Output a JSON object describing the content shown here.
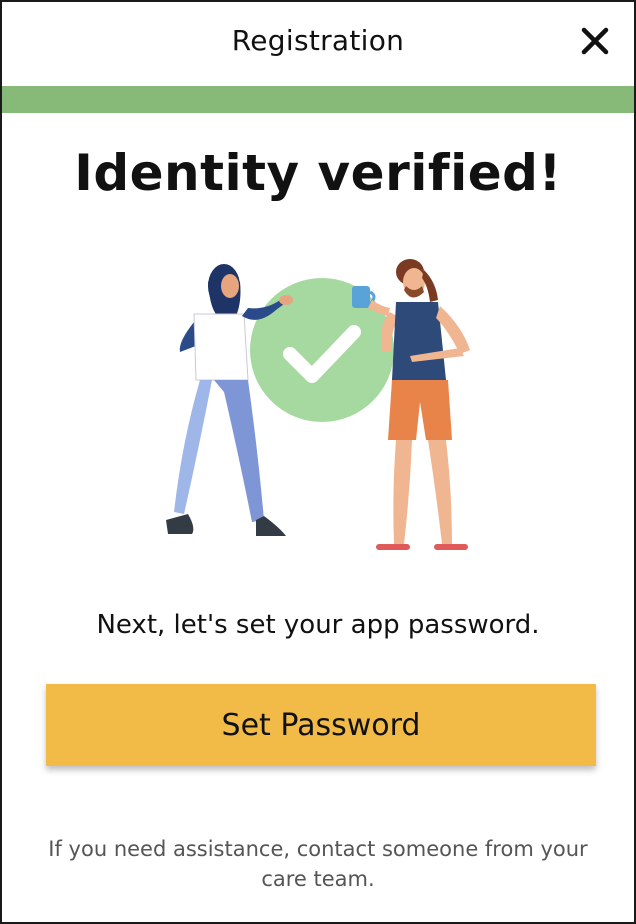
{
  "header": {
    "title": "Registration",
    "close_icon": "close-icon"
  },
  "progress": {
    "value": 1.0,
    "color": "#87b978"
  },
  "main": {
    "heading": "Identity verified!",
    "illustration_icon": "verified-checkmark-illustration",
    "subtext": "Next, let's set your app password.",
    "primary_button": "Set Password",
    "help_text": "If you need assistance, contact someone from your care team."
  },
  "colors": {
    "accent": "#f2bb48",
    "success": "#87b978",
    "check_circle": "#a6d9a0"
  }
}
